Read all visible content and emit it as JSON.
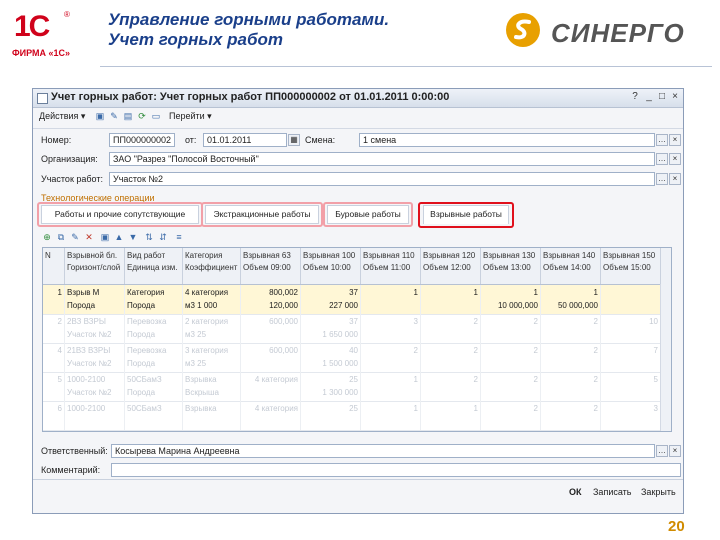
{
  "slide": {
    "title_line1": "Управление горными работами.",
    "title_line2": "Учет горных работ",
    "brand_1c_mark": "1С",
    "brand_1c_sub": "ФИРМА «1С»",
    "brand_sinergo": "СИНЕРГО",
    "page_number": "20",
    "colors": {
      "title": "#1a3f8a",
      "brand_red": "#d0021b",
      "page_number": "#d08b00",
      "highlight_pink": "#f2a0a8",
      "highlight_red": "#e0101c"
    }
  },
  "window": {
    "title": "Учет горных работ: Учет горных работ ПП000000002 от 01.01.2011 0:00:00",
    "controls": {
      "help": "?",
      "minimize": "_",
      "maximize": "□",
      "close": "×"
    }
  },
  "toolbar": {
    "actions_label": "Действия ▾",
    "goto_label": "Перейти ▾",
    "icons": [
      "save-icon",
      "edit-icon",
      "document-icon",
      "post-icon",
      "refresh-icon"
    ]
  },
  "form": {
    "number_label": "Номер:",
    "number_value": "ПП000000002",
    "date_label": "от:",
    "date_value": "01.01.2011",
    "shift_label": "Смена:",
    "shift_value": "1 смена",
    "org_label": "Организация:",
    "org_value": "ЗАО \"Разрез \"Полосой Восточный\"",
    "site_label": "Участок работ:",
    "site_value": "Участок №2"
  },
  "operations": {
    "section_title": "Технологические операции",
    "tabs": [
      {
        "label": "Работы и прочие сопутствующие"
      },
      {
        "label": "Экстракционные работы"
      },
      {
        "label": "Буровые работы"
      },
      {
        "label": "Взрывные работы"
      }
    ],
    "active_tab": 3
  },
  "grid": {
    "columns": [
      {
        "l1": "N",
        "l2": ""
      },
      {
        "l1": "Взрывной бл.",
        "l2": "Горизонт/слой"
      },
      {
        "l1": "Вид работ",
        "l2": "Единица изм."
      },
      {
        "l1": "Категория",
        "l2": "Коэффициент"
      },
      {
        "l1": "Взрывная 63",
        "l2": "Объем 09:00"
      },
      {
        "l1": "Взрывная 100",
        "l2": "Объем 10:00"
      },
      {
        "l1": "Взрывная 110",
        "l2": "Объем 11:00"
      },
      {
        "l1": "Взрывная 120",
        "l2": "Объем 12:00"
      },
      {
        "l1": "Взрывная 130",
        "l2": "Объем 13:00"
      },
      {
        "l1": "Взрывная 140",
        "l2": "Объем 14:00"
      },
      {
        "l1": "Взрывная 150",
        "l2": "Объем 15:00"
      }
    ],
    "rows": [
      {
        "n": "1",
        "c1": [
          "Взрыв М",
          "Порода"
        ],
        "c2": [
          "Категория",
          "Порода"
        ],
        "c3": [
          "4 категория",
          "м3 1 000"
        ],
        "c4": [
          "800,002",
          "120,000"
        ],
        "c5": [
          "37",
          "227 000"
        ],
        "c6": [
          "1",
          ""
        ],
        "c7": [
          "1",
          ""
        ],
        "c8": [
          "1",
          "10 000,000"
        ],
        "c9": [
          "1",
          "50 000,000"
        ],
        "c10": [
          "",
          ""
        ],
        "selected": true,
        "faded": false
      },
      {
        "n": "2",
        "c1": [
          "2ВЗ ВЗРЫ",
          "Участок №2"
        ],
        "c2": [
          "Перевозка",
          "Порода"
        ],
        "c3": [
          "2 категория",
          "м3 25"
        ],
        "c4": [
          "600,000",
          ""
        ],
        "c5": [
          "37",
          "1 650 000"
        ],
        "c6": [
          "3",
          ""
        ],
        "c7": [
          "2",
          ""
        ],
        "c8": [
          "2",
          ""
        ],
        "c9": [
          "2",
          ""
        ],
        "c10": [
          "10",
          ""
        ],
        "selected": false,
        "faded": true
      },
      {
        "n": "4",
        "c1": [
          "21ВЗ ВЗРЫ",
          "Участок №2"
        ],
        "c2": [
          "Перевозка",
          "Порода"
        ],
        "c3": [
          "3 категория",
          "м3 25"
        ],
        "c4": [
          "600,000",
          ""
        ],
        "c5": [
          "40",
          "1 500 000"
        ],
        "c6": [
          "2",
          ""
        ],
        "c7": [
          "2",
          ""
        ],
        "c8": [
          "2",
          ""
        ],
        "c9": [
          "2",
          ""
        ],
        "c10": [
          "7",
          ""
        ],
        "selected": false,
        "faded": true
      },
      {
        "n": "5",
        "c1": [
          "1000-2100",
          "Участок №2"
        ],
        "c2": [
          "50СБамЗ",
          "Порода"
        ],
        "c3": [
          "Взрывка",
          "Вскрыша"
        ],
        "c4": [
          "4 категория",
          ""
        ],
        "c5": [
          "25",
          "1 300 000"
        ],
        "c6": [
          "1",
          ""
        ],
        "c7": [
          "2",
          ""
        ],
        "c8": [
          "2",
          ""
        ],
        "c9": [
          "2",
          ""
        ],
        "c10": [
          "5",
          ""
        ],
        "selected": false,
        "faded": true
      },
      {
        "n": "6",
        "c1": [
          "1000-2100",
          ""
        ],
        "c2": [
          "50СБамЗ",
          ""
        ],
        "c3": [
          "Взрывка",
          ""
        ],
        "c4": [
          "4 категория",
          ""
        ],
        "c5": [
          "25",
          ""
        ],
        "c6": [
          "1",
          ""
        ],
        "c7": [
          "1",
          ""
        ],
        "c8": [
          "2",
          ""
        ],
        "c9": [
          "2",
          ""
        ],
        "c10": [
          "3",
          ""
        ],
        "selected": false,
        "faded": true
      }
    ]
  },
  "footer": {
    "responsible_label": "Ответственный:",
    "responsible_value": "Косырева Марина Андреевна",
    "comment_label": "Комментарий:",
    "comment_value": "",
    "ok_label": "ОК",
    "save_label": "Записать",
    "close_label": "Закрыть"
  }
}
